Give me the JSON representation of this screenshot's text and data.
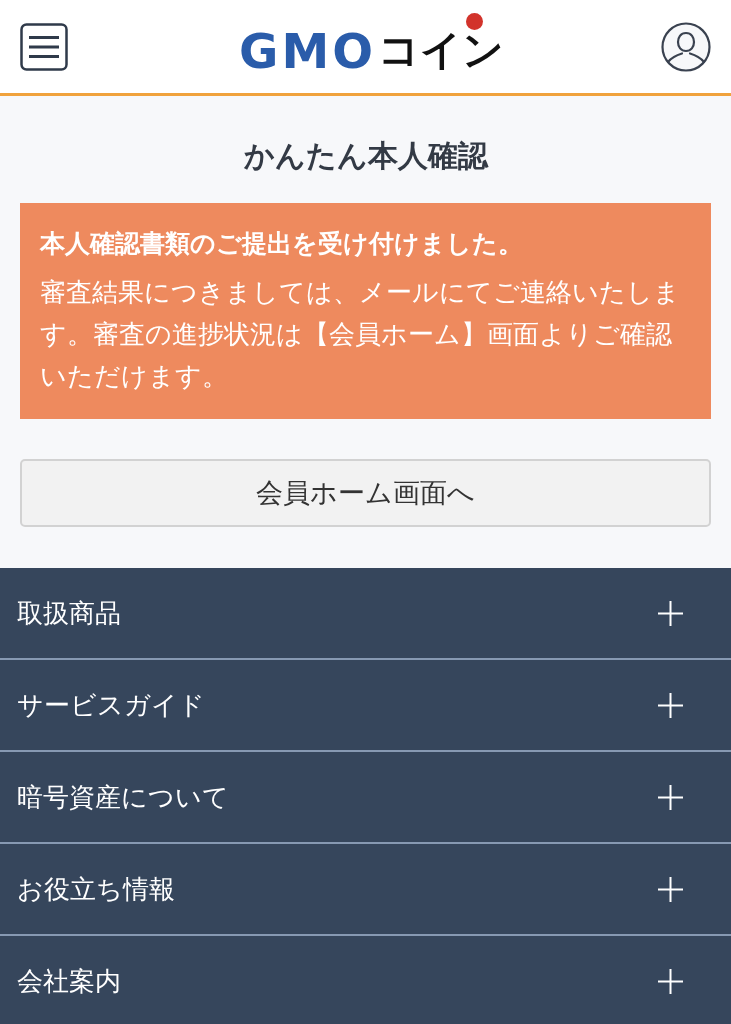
{
  "header": {
    "logo": {
      "brand": "GMO",
      "suffix": "コイン"
    }
  },
  "page_title": "かんたん本人確認",
  "notice": {
    "heading": "本人確認書類のご提出を受け付けました。",
    "body": "審査結果につきましては、メールにてご連絡いたします。審査の進捗状況は【会員ホーム】画面よりご確認いただけます。"
  },
  "home_button": "会員ホーム画面へ",
  "footer_menu": [
    {
      "label": "取扱商品",
      "expanded": false
    },
    {
      "label": "サービスガイド",
      "expanded": false
    },
    {
      "label": "暗号資産について",
      "expanded": false
    },
    {
      "label": "お役立ち情報",
      "expanded": false
    },
    {
      "label": "会社案内",
      "expanded": false
    }
  ]
}
